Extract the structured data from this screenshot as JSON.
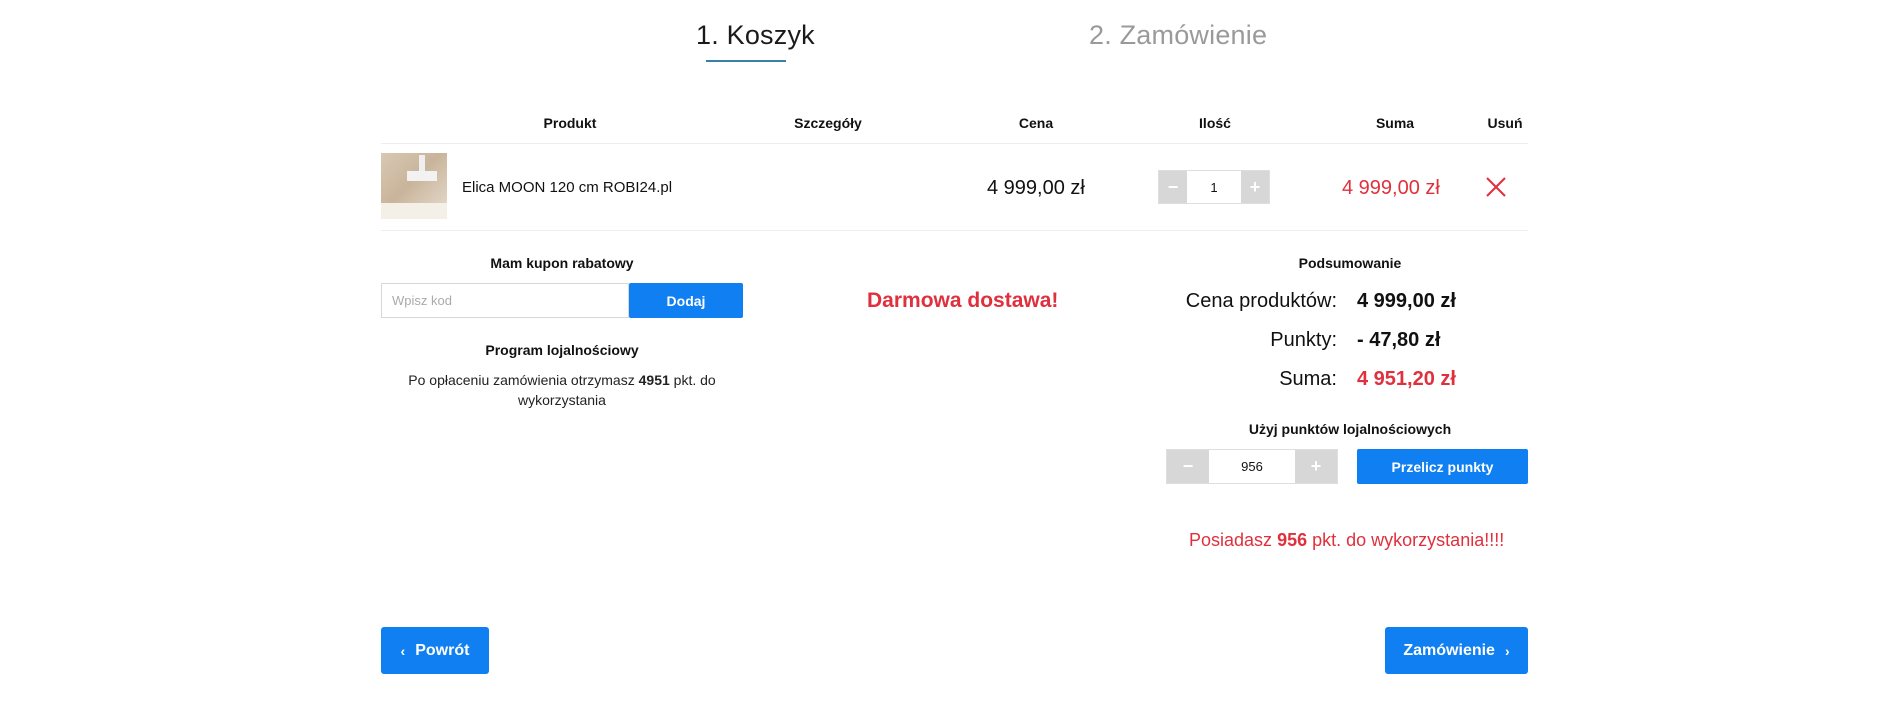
{
  "steps": {
    "step1": "1. Koszyk",
    "step2": "2. Zamówienie"
  },
  "table": {
    "headers": {
      "product": "Produkt",
      "details": "Szczegóły",
      "price": "Cena",
      "quantity": "Ilość",
      "sum": "Suma",
      "remove": "Usuń"
    },
    "rows": [
      {
        "name": "Elica MOON 120 cm ROBI24.pl",
        "price": "4 999,00 zł",
        "quantity": "1",
        "sum": "4 999,00 zł"
      }
    ]
  },
  "coupon": {
    "title": "Mam kupon rabatowy",
    "placeholder": "Wpisz kod",
    "button": "Dodaj"
  },
  "loyalty": {
    "title": "Program lojalnościowy",
    "text_before": "Po opłaceniu zamówienia otrzymasz",
    "points": "4951",
    "text_after_line1": "pkt. do",
    "text_after_line2": "wykorzystania"
  },
  "shipping": {
    "free_label": "Darmowa dostawa!"
  },
  "summary": {
    "title": "Podsumowanie",
    "products_label": "Cena produktów:",
    "products_value": "4 999,00 zł",
    "points_label": "Punkty:",
    "points_value": "- 47,80 zł",
    "total_label": "Suma:",
    "total_value": "4 951,20 zł"
  },
  "use_points": {
    "title": "Użyj punktów lojalnościowych",
    "value": "956",
    "button": "Przelicz punkty"
  },
  "points_message": {
    "before": "Posiadasz",
    "points": "956",
    "after": "pkt. do wykorzystania!!!!"
  },
  "nav": {
    "back": "Powrót",
    "order": "Zamówienie"
  },
  "colors": {
    "accent_blue": "#0f7ff2",
    "price_red": "#e0303d"
  }
}
